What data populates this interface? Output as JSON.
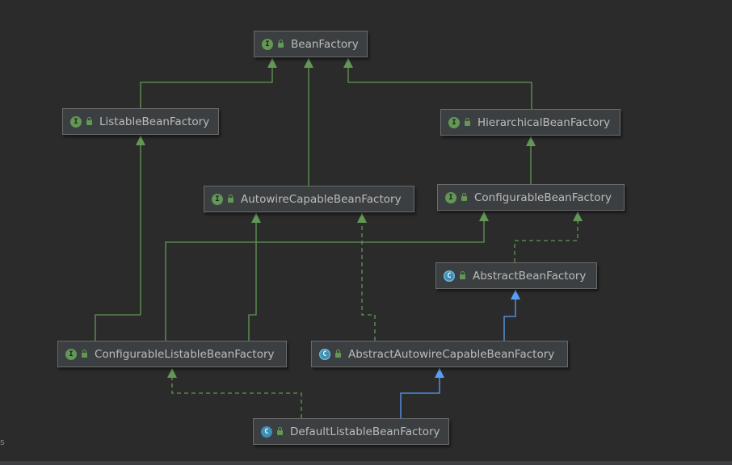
{
  "diagram": {
    "nodes": [
      {
        "id": "BeanFactory",
        "label": "BeanFactory",
        "kind": "interface",
        "icon": "interface-icon"
      },
      {
        "id": "ListableBeanFactory",
        "label": "ListableBeanFactory",
        "kind": "interface",
        "icon": "interface-icon"
      },
      {
        "id": "HierarchicalBeanFactory",
        "label": "HierarchicalBeanFactory",
        "kind": "interface",
        "icon": "interface-icon"
      },
      {
        "id": "AutowireCapableBeanFactory",
        "label": "AutowireCapableBeanFactory",
        "kind": "interface",
        "icon": "interface-icon"
      },
      {
        "id": "ConfigurableBeanFactory",
        "label": "ConfigurableBeanFactory",
        "kind": "interface",
        "icon": "interface-icon"
      },
      {
        "id": "AbstractBeanFactory",
        "label": "AbstractBeanFactory",
        "kind": "abstract-class",
        "icon": "abstract-class-icon"
      },
      {
        "id": "ConfigurableListableBeanFactory",
        "label": "ConfigurableListableBeanFactory",
        "kind": "interface",
        "icon": "interface-icon"
      },
      {
        "id": "AbstractAutowireCapableBeanFactory",
        "label": "AbstractAutowireCapableBeanFactory",
        "kind": "abstract-class",
        "icon": "abstract-class-icon"
      },
      {
        "id": "DefaultListableBeanFactory",
        "label": "DefaultListableBeanFactory",
        "kind": "class",
        "icon": "class-icon"
      }
    ],
    "edges": [
      {
        "from": "ListableBeanFactory",
        "to": "BeanFactory",
        "type": "extends-interface"
      },
      {
        "from": "AutowireCapableBeanFactory",
        "to": "BeanFactory",
        "type": "extends-interface"
      },
      {
        "from": "HierarchicalBeanFactory",
        "to": "BeanFactory",
        "type": "extends-interface"
      },
      {
        "from": "ConfigurableBeanFactory",
        "to": "HierarchicalBeanFactory",
        "type": "extends-interface"
      },
      {
        "from": "ConfigurableListableBeanFactory",
        "to": "ListableBeanFactory",
        "type": "extends-interface"
      },
      {
        "from": "ConfigurableListableBeanFactory",
        "to": "ConfigurableBeanFactory",
        "type": "extends-interface"
      },
      {
        "from": "ConfigurableListableBeanFactory",
        "to": "AutowireCapableBeanFactory",
        "type": "extends-interface"
      },
      {
        "from": "AbstractBeanFactory",
        "to": "ConfigurableBeanFactory",
        "type": "implements"
      },
      {
        "from": "AbstractAutowireCapableBeanFactory",
        "to": "AutowireCapableBeanFactory",
        "type": "implements"
      },
      {
        "from": "AbstractAutowireCapableBeanFactory",
        "to": "AbstractBeanFactory",
        "type": "extends-class"
      },
      {
        "from": "DefaultListableBeanFactory",
        "to": "ConfigurableListableBeanFactory",
        "type": "implements"
      },
      {
        "from": "DefaultListableBeanFactory",
        "to": "AbstractAutowireCapableBeanFactory",
        "type": "extends-class"
      }
    ],
    "icon_glyphs": {
      "interface": "I",
      "class": "C",
      "abstract-class": "C"
    },
    "colors": {
      "background": "#2b2b2b",
      "node_fill": "#3c3f41",
      "node_border": "#6b6b6b",
      "text": "#bbbbbb",
      "interface_edge": "#629755",
      "class_edge": "#589df6"
    },
    "status_fragment": "s"
  }
}
